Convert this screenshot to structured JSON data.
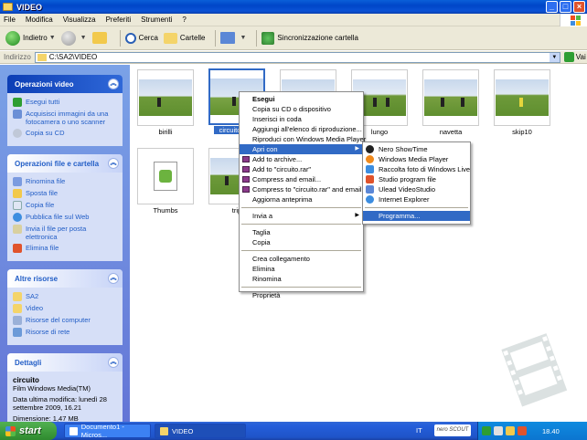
{
  "window": {
    "title": "VIDEO"
  },
  "menu": [
    "File",
    "Modifica",
    "Visualizza",
    "Preferiti",
    "Strumenti",
    "?"
  ],
  "toolbar": {
    "back": "Indietro",
    "search": "Cerca",
    "folders": "Cartelle",
    "sync": "Sincronizzazione cartella"
  },
  "address": {
    "label": "Indirizzo",
    "path": "C:\\SA2\\VIDEO",
    "go": "Vai"
  },
  "leftpane": {
    "video_tasks": {
      "title": "Operazioni video",
      "items": [
        "Esegui tutti",
        "Acquisisci immagini da una fotocamera o uno scanner",
        "Copia su CD"
      ]
    },
    "file_tasks": {
      "title": "Operazioni file e cartella",
      "items": [
        "Rinomina file",
        "Sposta file",
        "Copia file",
        "Pubblica file sul Web",
        "Invia il file per posta elettronica",
        "Elimina file"
      ]
    },
    "other_places": {
      "title": "Altre risorse",
      "items": [
        "SA2",
        "Video",
        "Risorse del computer",
        "Risorse di rete"
      ]
    },
    "details": {
      "title": "Dettagli",
      "name": "circuito",
      "type": "Film Windows Media(TM)",
      "modified": "Data ultima modifica: lunedì 28 settembre 2009, 16.21",
      "size": "Dimensione: 1,47 MB"
    }
  },
  "files": [
    {
      "label": "birilli"
    },
    {
      "label": "circuito"
    },
    {
      "label": ""
    },
    {
      "label": "lungo"
    },
    {
      "label": "navetta"
    },
    {
      "label": "skip10"
    },
    {
      "label": "Thumbs"
    },
    {
      "label": "trip"
    }
  ],
  "context_menu": [
    "Esegui",
    "Copia su CD o dispositivo",
    "Inserisci in coda",
    "Aggiungi all'elenco di riproduzione...",
    "Riproduci con Windows Media Player",
    "Apri con",
    "Add to archive...",
    "Add to \"circuito.rar\"",
    "Compress and email...",
    "Compress to \"circuito.rar\" and email",
    "Aggiorna anteprima",
    "Invia a",
    "Taglia",
    "Copia",
    "Crea collegamento",
    "Elimina",
    "Rinomina",
    "Proprietà"
  ],
  "open_with": [
    "Nero ShowTime",
    "Windows Media Player",
    "Raccolta foto di Windows Live",
    "Studio program file",
    "Ulead VideoStudio",
    "Internet Explorer",
    "Programma..."
  ],
  "taskbar": {
    "start": "start",
    "items": [
      "Documento1 - Micros...",
      "VIDEO"
    ],
    "lang": "IT",
    "nero": "nero SCOUT",
    "clock": "18.40"
  },
  "colors": {
    "selection": "#316ac5",
    "taskpane": "#7ba2e7",
    "titlebar": "#0a5fd8"
  }
}
